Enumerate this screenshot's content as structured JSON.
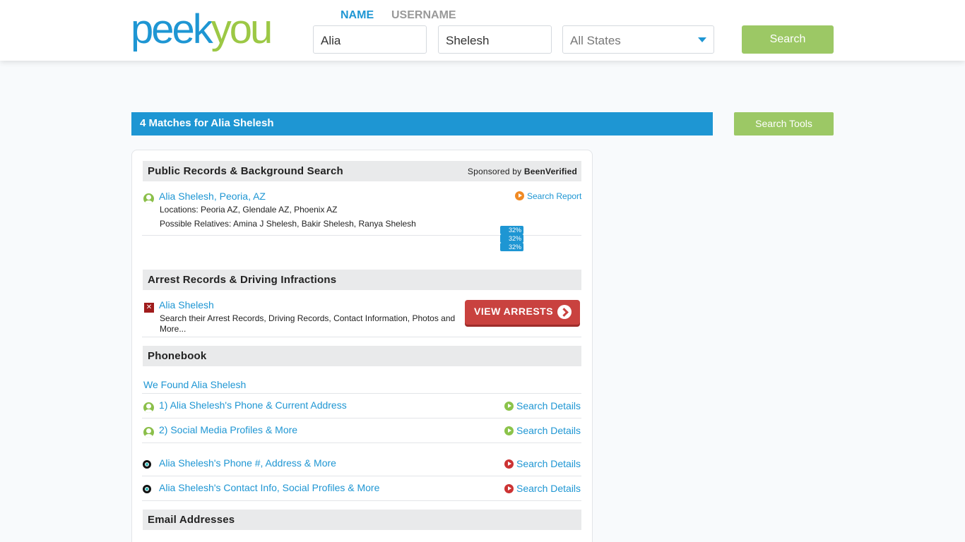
{
  "header": {
    "logo": {
      "part1": "peek",
      "part2": "you"
    },
    "tabs": {
      "name": "NAME",
      "username": "USERNAME"
    },
    "first_name": "Alia",
    "last_name": "Shelesh",
    "state": "All States",
    "search_label": "Search"
  },
  "results": {
    "title": "4 Matches for Alia Shelesh",
    "tools_label": "Search Tools"
  },
  "public_records": {
    "heading": "Public Records & Background Search",
    "sponsored_prefix": "Sponsored by",
    "sponsor_name": "BeenVerified",
    "person_link": "Alia Shelesh, Peoria, AZ",
    "locations": "Locations: Peoria AZ, Glendale AZ, Phoenix AZ",
    "relatives": "Possible Relatives: Amina J Shelesh, Bakir Shelesh, Ranya Shelesh",
    "report_link": "Search Report",
    "progress": [
      "32%",
      "32%",
      "32%"
    ]
  },
  "arrest_records": {
    "heading": "Arrest Records & Driving Infractions",
    "person_link": "Alia Shelesh",
    "description": "Search their Arrest Records, Driving Records, Contact Information, Photos and More...",
    "button_label": "VIEW ARRESTS"
  },
  "phonebook": {
    "heading": "Phonebook",
    "found_label": "We Found Alia Shelesh",
    "items": [
      {
        "label": "1) Alia Shelesh's Phone & Current Address",
        "action": "Search Details"
      },
      {
        "label": "2) Social Media Profiles & More",
        "action": "Search Details"
      },
      {
        "label": "Alia Shelesh's Phone #, Address & More",
        "action": "Search Details"
      },
      {
        "label": "Alia Shelesh's Contact Info, Social Profiles & More",
        "action": "Search Details"
      }
    ]
  },
  "email": {
    "heading": "Email Addresses"
  },
  "colors": {
    "brand_blue": "#1e96d3",
    "brand_green": "#9cc865",
    "arrest_red": "#c9423f"
  }
}
